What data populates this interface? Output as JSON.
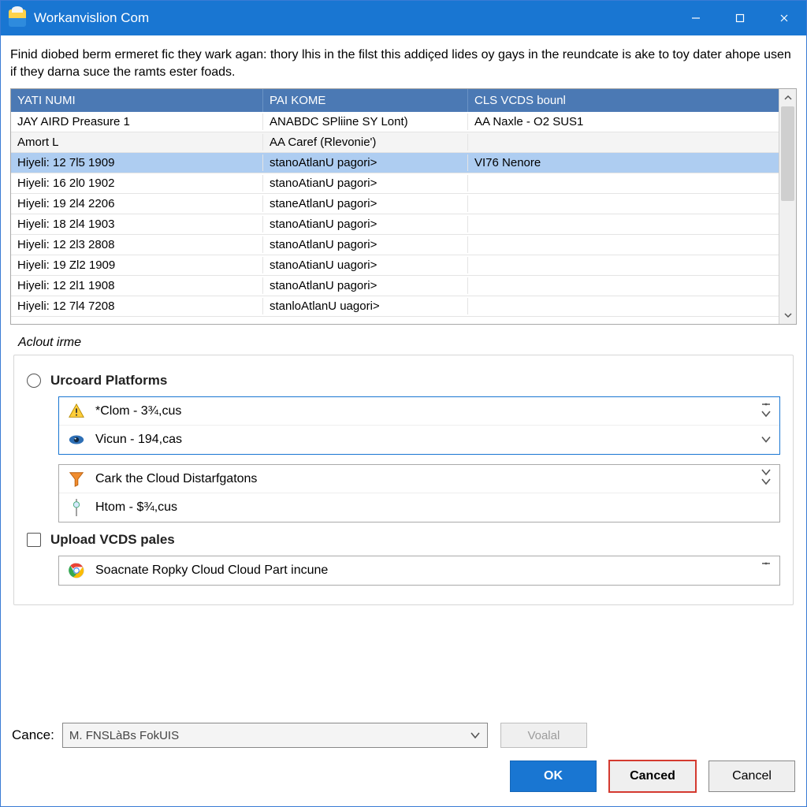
{
  "window": {
    "title": "Workanvislion Com"
  },
  "intro": "Finid diobed berm ermeret fic they wark agan: thory lhis in the filst this addiçed lides oy gays in the reundcate is ake to toy dater ahope usen if they darna suce the ramts ester foads.",
  "table": {
    "headers": {
      "c1": "YATI NUMI",
      "c2": "PAI KOME",
      "c3": "CLS VCDS bounl"
    },
    "rows": [
      {
        "c1": "JAY AIRD Preasure 1",
        "c2": "ANABDC SPliine SY Lont)",
        "c3": "AA Naxle - O2 SUS1",
        "style": ""
      },
      {
        "c1": "Amort L",
        "c2": "AA Caref (Rlevonie')",
        "c3": "",
        "style": "alt"
      },
      {
        "c1": "Hiyeli: 12 7l5 1909",
        "c2": "stanoAtlanU pagori>",
        "c3": "VI76 Nenore",
        "style": "selected"
      },
      {
        "c1": "Hiyeli: 16 2l0 1902",
        "c2": "stanoAtianU pagori>",
        "c3": "",
        "style": ""
      },
      {
        "c1": "Hiyeli: 19 2l4 2206",
        "c2": "staneAtlanU pagori>",
        "c3": "",
        "style": ""
      },
      {
        "c1": "Hiyeli: 18 2l4 1903",
        "c2": "stanoAtianU pagori>",
        "c3": "",
        "style": ""
      },
      {
        "c1": "Hiyeli: 12 2l3 2808",
        "c2": "stanoAtlanU pagori>",
        "c3": "",
        "style": ""
      },
      {
        "c1": "Hiyeli: 19 Zl2 1909",
        "c2": "stanoAtianU uagori>",
        "c3": "",
        "style": ""
      },
      {
        "c1": "Hiyeli: 12 2l1 1908",
        "c2": "stanoAtlanU pagori>",
        "c3": "",
        "style": ""
      },
      {
        "c1": "Hiyeli: 12 7l4 7208",
        "c2": "stanloAtlanU uagori>",
        "c3": "",
        "style": ""
      }
    ]
  },
  "group_label": "Aclout irme",
  "option1": "Urcoard Platforms",
  "option2": "Upload VCDS pales",
  "panel1": {
    "r1": "*Clom - 3¾,cus",
    "r2": "Vicun - 194,cas"
  },
  "panel2": {
    "r1": "Cark the Cloud Distarfgatons",
    "r2": "Htom - $¾,cus"
  },
  "panel3": {
    "r1": "Soacnate Ropky Cloud Cloud Part incune"
  },
  "bottom": {
    "combo_label": "Cance:",
    "combo_value": "M. FNSLàBs FokUIS",
    "disabled_btn": "Voalal",
    "ok": "OK",
    "canced": "Canced",
    "cancel": "Cancel"
  }
}
